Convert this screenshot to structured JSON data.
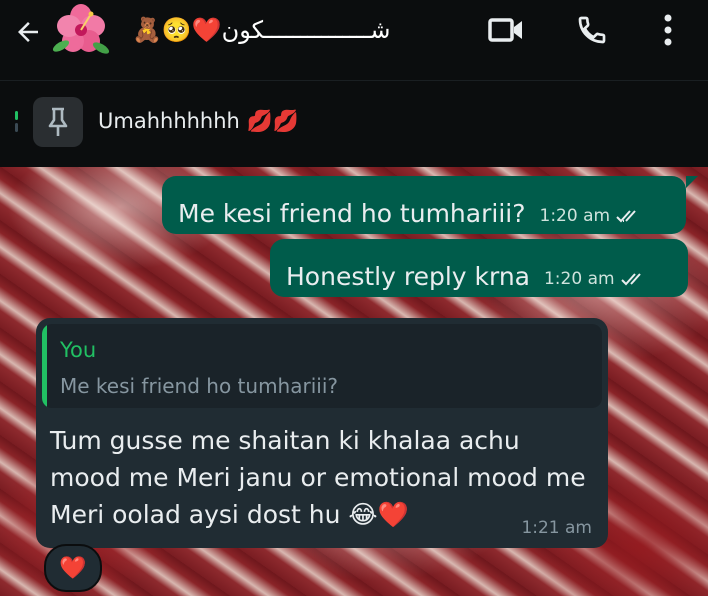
{
  "header": {
    "contact_name": "شـــــــــــــــكون",
    "emojis": "🧸🥺❤️"
  },
  "pinned": {
    "text": "Umahhhhhhh 💋💋"
  },
  "messages": [
    {
      "text": "Me kesi friend ho tumhariii?",
      "time": "1:20 am"
    },
    {
      "text": "Honestly reply krna",
      "time": "1:20 am"
    }
  ],
  "reply": {
    "quote_author": "You",
    "quote_text": "Me kesi friend ho tumhariii?",
    "text": "Tum gusse me shaitan ki khalaa achu mood me Meri janu or emotional mood me Meri oolad aysi dost hu 😂❤️",
    "time": "1:21 am",
    "reaction": "❤️"
  },
  "icons": {
    "back": "arrow-left-icon",
    "video": "video-call-icon",
    "call": "phone-icon",
    "menu": "more-vert-icon",
    "pin": "pin-icon",
    "ticks": "double-check-icon"
  },
  "colors": {
    "outgoing_bubble": "#005c4b",
    "incoming_bubble": "#202c33",
    "quote_accent": "#21c063"
  }
}
